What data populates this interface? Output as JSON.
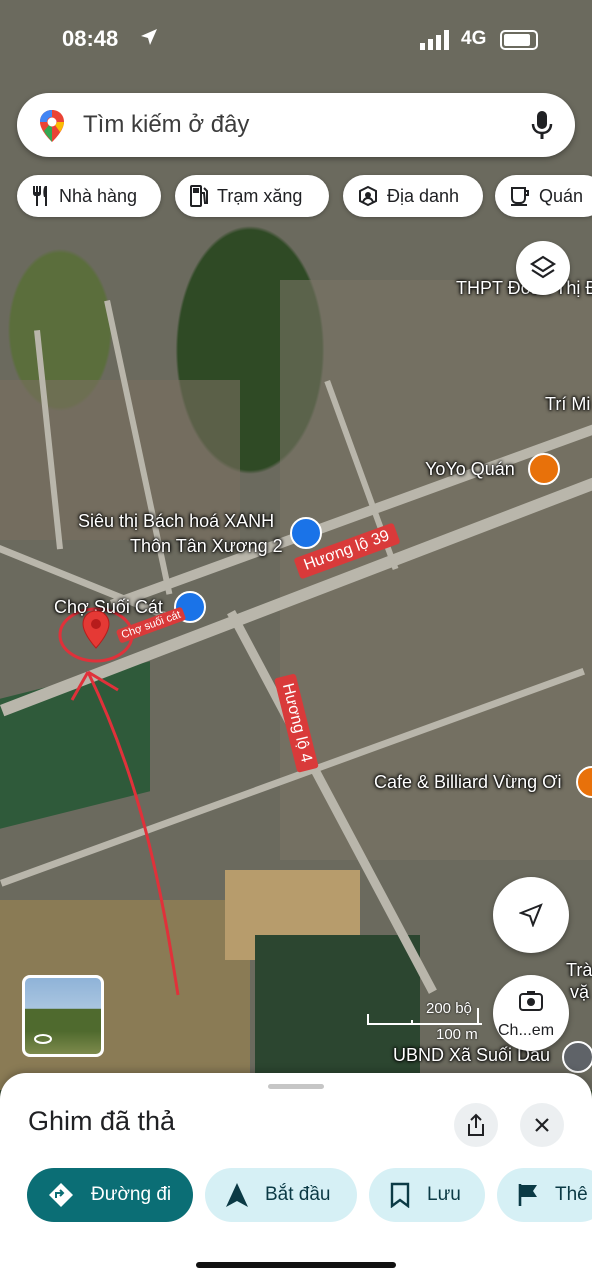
{
  "status_bar": {
    "time": "08:48",
    "network": "4G"
  },
  "search": {
    "placeholder": "Tìm kiếm ở đây"
  },
  "chips": [
    {
      "label": "Nhà hàng",
      "icon": "restaurant-icon"
    },
    {
      "label": "Trạm xăng",
      "icon": "gas-station-icon"
    },
    {
      "label": "Địa danh",
      "icon": "landmark-icon"
    },
    {
      "label": "Quán",
      "icon": "coffee-icon"
    }
  ],
  "map": {
    "pois": {
      "school": "THPT Đoàn Thị Đ",
      "tri": "Trí Mi",
      "yoyo": "YoYo Quán",
      "bachhoa_1": "Siêu thị Bách hoá XANH",
      "bachhoa_2": "Thôn Tân Xương 2",
      "market": "Chợ Suối Cát",
      "cafe": "Cafe & Billiard Vừng Ơi",
      "tra": "Trà",
      "vang": "vặ",
      "ubnd": "UBND Xã Suối Dầu"
    },
    "road_labels": {
      "hl39": "Hương lộ 39",
      "hl4": "Hương lộ 4"
    },
    "handwritten_note": "Chợ suối cát",
    "scale": {
      "feet": "200 bộ",
      "meters": "100 m"
    },
    "lens_label": "Ch...em",
    "colors": {
      "road_label": "#d93a3a",
      "pin": "#e53935",
      "annotation": "#e0313a",
      "shopping": "#1a73e8",
      "cafe": "#e8710a"
    }
  },
  "sheet": {
    "title": "Ghim đã thả",
    "actions": [
      {
        "label": "Đường đi",
        "icon": "directions-icon",
        "primary": true
      },
      {
        "label": "Bắt đầu",
        "icon": "navigation-arrow-icon"
      },
      {
        "label": "Lưu",
        "icon": "bookmark-icon"
      },
      {
        "label": "Thê",
        "icon": "flag-icon"
      }
    ],
    "colors": {
      "primary_bg": "#0b6e75",
      "secondary_bg": "#d6f0f5",
      "secondary_fg": "#0b3a45"
    }
  }
}
